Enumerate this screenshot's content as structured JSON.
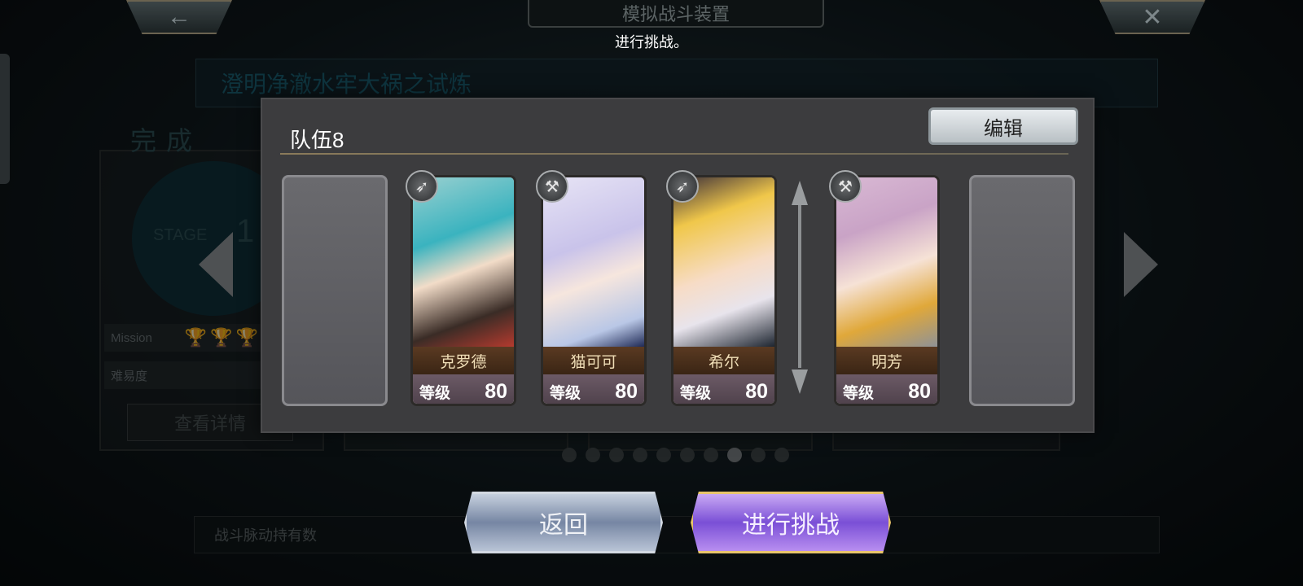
{
  "header": {
    "title": "模拟战斗装置",
    "instruction": "进行挑战。",
    "back_icon": "←",
    "close_icon": "✕"
  },
  "background": {
    "stage_banner": "澄明净澈水牢大祸之试炼",
    "complete_label": "完成",
    "stage_label": "STAGE",
    "stage_number": "1",
    "mission_label": "Mission",
    "trophies": "🏆🏆🏆",
    "difficulty_label": "难易度",
    "detail_button": "查看详情",
    "pulse_label": "战斗脉动持有数",
    "page_dots": 10,
    "active_dot": 7
  },
  "modal": {
    "team_name": "队伍8",
    "edit_button": "编辑",
    "level_label": "等级",
    "members": [
      {
        "name": "克罗德",
        "level": "80",
        "weapon_icon": "bow-icon"
      },
      {
        "name": "猫可可",
        "level": "80",
        "weapon_icon": "axe-icon"
      },
      {
        "name": "希尔",
        "level": "80",
        "weapon_icon": "bow-icon"
      },
      {
        "name": "明芳",
        "level": "80",
        "weapon_icon": "hammer-icon"
      }
    ]
  },
  "actions": {
    "back_button": "返回",
    "challenge_button": "进行挑战"
  },
  "colors": {
    "modal_bg": "#3c3c3e",
    "challenge_accent": "#7a4fd6",
    "back_accent": "#7686a3",
    "gold_border": "#e8c56a"
  }
}
